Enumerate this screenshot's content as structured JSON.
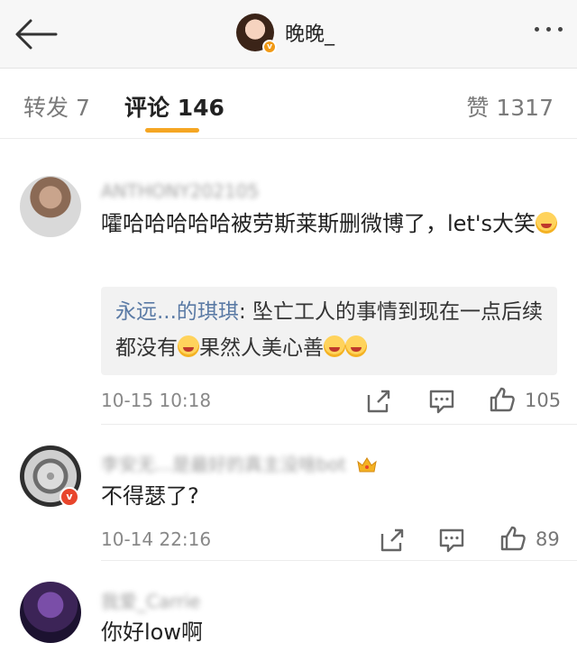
{
  "header": {
    "title": "晚晚_",
    "back_icon": "arrow-left-icon",
    "more_icon": "more-dots-icon",
    "verified_badge": "v"
  },
  "tabs": {
    "repost": "转发 7",
    "comments": "评论 146",
    "likes": "赞 1317",
    "accent_color": "#f5a623"
  },
  "comments": [
    {
      "name": "ANTHONY202105",
      "text_before_emoji": "嚯哈哈哈哈哈被劳斯莱斯删微博了，let's大笑",
      "reply": {
        "name": "永远...的琪琪",
        "text_part1": ": 坠亡工人的事情到现在一点后续都没有",
        "text_part2": "果然人美心善"
      },
      "time": "10-15 10:18",
      "likes": "105"
    },
    {
      "name": "李安无...是最好的真主没啥bot",
      "badge": "v",
      "text": "不得瑟了?",
      "time": "10-14 22:16",
      "likes": "89"
    },
    {
      "name": "我爱_Carrie",
      "text": "你好low啊"
    }
  ]
}
